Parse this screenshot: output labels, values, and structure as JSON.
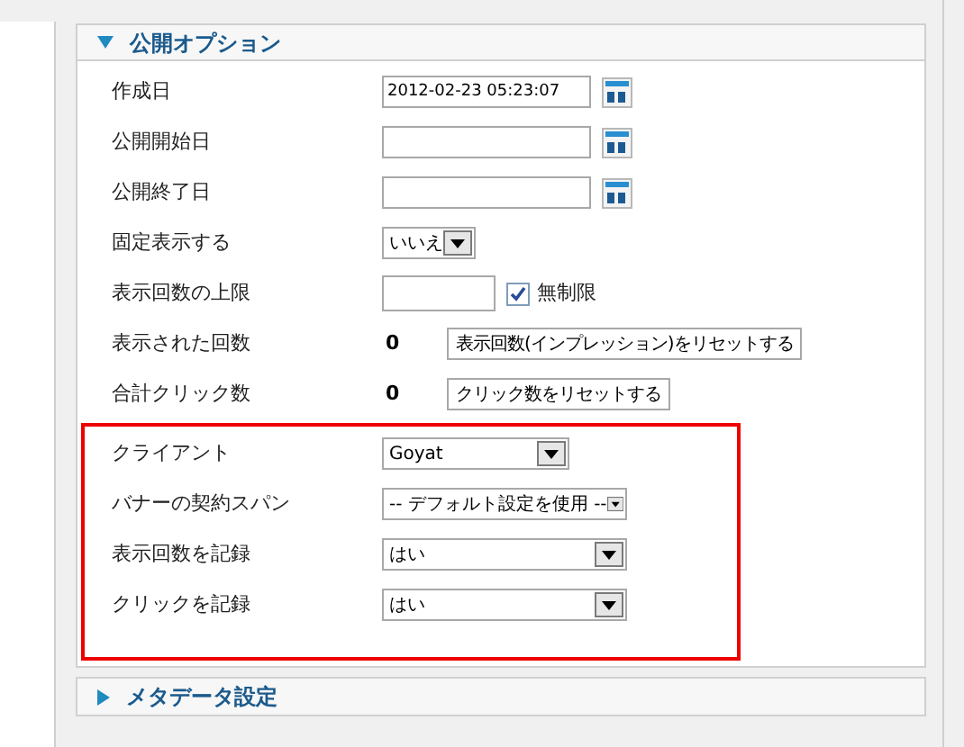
{
  "sections": [
    {
      "title": "公開オプション",
      "expanded": true,
      "fields": [
        {
          "kind": "date",
          "label": "作成日",
          "value": "2012-02-23 05:23:07"
        },
        {
          "kind": "date",
          "label": "公開開始日"
        },
        {
          "kind": "date",
          "label": "公開終了日"
        },
        {
          "kind": "toggle",
          "label": "固定表示する",
          "value": "いいえ"
        },
        {
          "kind": "limit",
          "label": "表示回数の上限",
          "checkbox_label": "無制限",
          "checked": true
        },
        {
          "kind": "counter",
          "label": "表示された回数",
          "count": "0",
          "button": "表示回数(インプレッション)をリセットする"
        },
        {
          "kind": "counter",
          "label": "合計クリック数",
          "count": "0",
          "button": "クリック数をリセットする"
        }
      ],
      "highlighted_fields": [
        {
          "kind": "select",
          "label": "クライアント",
          "value": "Goyat"
        },
        {
          "kind": "select",
          "label": "バナーの契約スパン",
          "value": "-- デフォルト設定を使用 --"
        },
        {
          "kind": "select",
          "label": "表示回数を記録",
          "value": "はい"
        },
        {
          "kind": "select",
          "label": "クリックを記録",
          "value": "はい"
        }
      ]
    },
    {
      "title": "メタデータ設定",
      "expanded": false
    }
  ]
}
